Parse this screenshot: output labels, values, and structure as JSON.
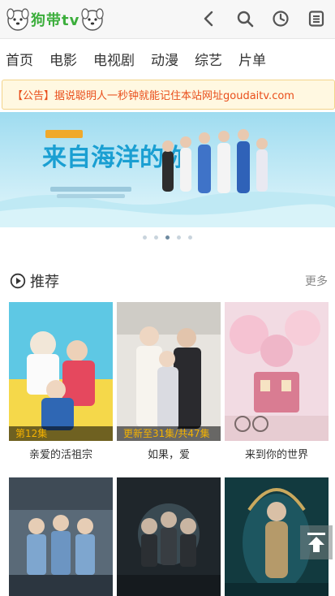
{
  "header": {
    "logo_text": "狗带tv",
    "icons": [
      "back-arrow-icon",
      "search-icon",
      "history-clock-icon",
      "menu-list-icon"
    ]
  },
  "nav": {
    "items": [
      {
        "label": "首页"
      },
      {
        "label": "电影"
      },
      {
        "label": "电视剧"
      },
      {
        "label": "动漫"
      },
      {
        "label": "综艺"
      },
      {
        "label": "片单"
      }
    ]
  },
  "notice": {
    "text": "【公告】据说聪明人一秒钟就能记住本站网址goudaitv.com"
  },
  "banner": {
    "title_art": "来自海洋的你",
    "slide_count": 5,
    "active_slide": 3
  },
  "recommend": {
    "title": "推荐",
    "more_label": "更多",
    "cards": [
      {
        "title": "亲爱的活祖宗",
        "badge": "第12集"
      },
      {
        "title": "如果，爱",
        "badge": "更新至31集/共47集"
      },
      {
        "title": "来到你的世界",
        "badge": ""
      },
      {
        "title": "",
        "badge": ""
      },
      {
        "title": "",
        "badge": ""
      },
      {
        "title": "",
        "badge": ""
      }
    ]
  },
  "colors": {
    "brand_green": "#3cae3c",
    "notice_red": "#e94e1b",
    "badge_gold": "#f5b300"
  }
}
